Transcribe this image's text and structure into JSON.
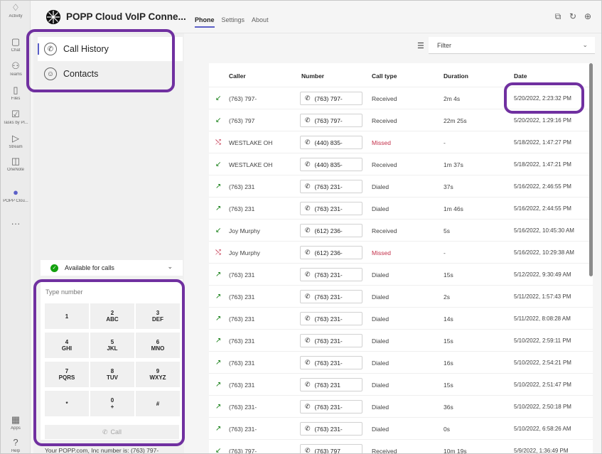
{
  "rail": [
    {
      "label": "Activity",
      "icon": "bell-icon"
    },
    {
      "label": "Chat",
      "icon": "chat-icon"
    },
    {
      "label": "Teams",
      "icon": "teams-icon"
    },
    {
      "label": "Files",
      "icon": "file-icon"
    },
    {
      "label": "Tasks by Pl...",
      "icon": "tasks-icon"
    },
    {
      "label": "Stream",
      "icon": "stream-icon"
    },
    {
      "label": "OneNote",
      "icon": "onenote-icon"
    },
    {
      "label": "POPP Clou...",
      "icon": "popp-icon"
    },
    {
      "label": "...",
      "icon": "more-icon"
    },
    {
      "label": "Apps",
      "icon": "apps-icon"
    },
    {
      "label": "Help",
      "icon": "help-icon"
    }
  ],
  "header": {
    "title": "POPP Cloud VoIP Conne...",
    "tabs": [
      "Phone",
      "Settings",
      "About"
    ]
  },
  "nav": {
    "call_history": "Call History",
    "contacts": "Contacts"
  },
  "availability": "Available for calls",
  "dialer": {
    "placeholder": "Type number",
    "keys": [
      {
        "d": "1",
        "l": ""
      },
      {
        "d": "2",
        "l": "ABC"
      },
      {
        "d": "3",
        "l": "DEF"
      },
      {
        "d": "4",
        "l": "GHI"
      },
      {
        "d": "5",
        "l": "JKL"
      },
      {
        "d": "6",
        "l": "MNO"
      },
      {
        "d": "7",
        "l": "PQRS"
      },
      {
        "d": "8",
        "l": "TUV"
      },
      {
        "d": "9",
        "l": "WXYZ"
      },
      {
        "d": "*",
        "l": ""
      },
      {
        "d": "0",
        "l": "+"
      },
      {
        "d": "#",
        "l": ""
      }
    ],
    "call_label": "Call"
  },
  "footer_note": "Your POPP.com, Inc number is: (763) 797-",
  "filter": {
    "label": "Filter"
  },
  "table": {
    "headers": [
      "Caller",
      "Number",
      "Call type",
      "Duration",
      "Date"
    ],
    "rows": [
      {
        "caller": "(763) 797-",
        "number": "(763) 797-",
        "type": "Received",
        "duration": "2m 4s",
        "date": "5/20/2022, 2:23:32 PM",
        "kind": "received"
      },
      {
        "caller": "(763) 797",
        "number": "(763) 797-",
        "type": "Received",
        "duration": "22m 25s",
        "date": "5/20/2022, 1:29:16 PM",
        "kind": "received"
      },
      {
        "caller": "WESTLAKE OH",
        "number": "(440) 835-",
        "type": "Missed",
        "duration": "-",
        "date": "5/18/2022, 1:47:27 PM",
        "kind": "missed"
      },
      {
        "caller": "WESTLAKE OH",
        "number": "(440) 835-",
        "type": "Received",
        "duration": "1m 37s",
        "date": "5/18/2022, 1:47:21 PM",
        "kind": "received"
      },
      {
        "caller": "(763) 231",
        "number": "(763) 231-",
        "type": "Dialed",
        "duration": "37s",
        "date": "5/16/2022, 2:46:55 PM",
        "kind": "dialed"
      },
      {
        "caller": "(763) 231",
        "number": "(763) 231-",
        "type": "Dialed",
        "duration": "1m 46s",
        "date": "5/16/2022, 2:44:55 PM",
        "kind": "dialed"
      },
      {
        "caller": "Joy Murphy",
        "number": "(612) 236-",
        "type": "Received",
        "duration": "5s",
        "date": "5/16/2022, 10:45:30 AM",
        "kind": "received"
      },
      {
        "caller": "Joy Murphy",
        "number": "(612) 236-",
        "type": "Missed",
        "duration": "-",
        "date": "5/16/2022, 10:29:38 AM",
        "kind": "missed"
      },
      {
        "caller": "(763) 231",
        "number": "(763) 231-",
        "type": "Dialed",
        "duration": "15s",
        "date": "5/12/2022, 9:30:49 AM",
        "kind": "dialed"
      },
      {
        "caller": "(763) 231",
        "number": "(763) 231-",
        "type": "Dialed",
        "duration": "2s",
        "date": "5/11/2022, 1:57:43 PM",
        "kind": "dialed"
      },
      {
        "caller": "(763) 231",
        "number": "(763) 231-",
        "type": "Dialed",
        "duration": "14s",
        "date": "5/11/2022, 8:08:28 AM",
        "kind": "dialed"
      },
      {
        "caller": "(763) 231",
        "number": "(763) 231-",
        "type": "Dialed",
        "duration": "15s",
        "date": "5/10/2022, 2:59:11 PM",
        "kind": "dialed"
      },
      {
        "caller": "(763) 231",
        "number": "(763) 231-",
        "type": "Dialed",
        "duration": "16s",
        "date": "5/10/2022, 2:54:21 PM",
        "kind": "dialed"
      },
      {
        "caller": "(763) 231",
        "number": "(763) 231",
        "type": "Dialed",
        "duration": "15s",
        "date": "5/10/2022, 2:51:47 PM",
        "kind": "dialed"
      },
      {
        "caller": "(763) 231-",
        "number": "(763) 231-",
        "type": "Dialed",
        "duration": "36s",
        "date": "5/10/2022, 2:50:18 PM",
        "kind": "dialed"
      },
      {
        "caller": "(763) 231-",
        "number": "(763) 231-",
        "type": "Dialed",
        "duration": "0s",
        "date": "5/10/2022, 6:58:26 AM",
        "kind": "dialed"
      },
      {
        "caller": "(763) 797-",
        "number": "(763) 797",
        "type": "Received",
        "duration": "10m 19s",
        "date": "5/9/2022, 1:36:49 PM",
        "kind": "received"
      }
    ]
  },
  "colors": {
    "accent": "#5b5fc7",
    "received_icon": "#107c10",
    "missed_icon": "#c4314b",
    "dialed_icon": "#107c10",
    "callout": "#7030a0"
  }
}
